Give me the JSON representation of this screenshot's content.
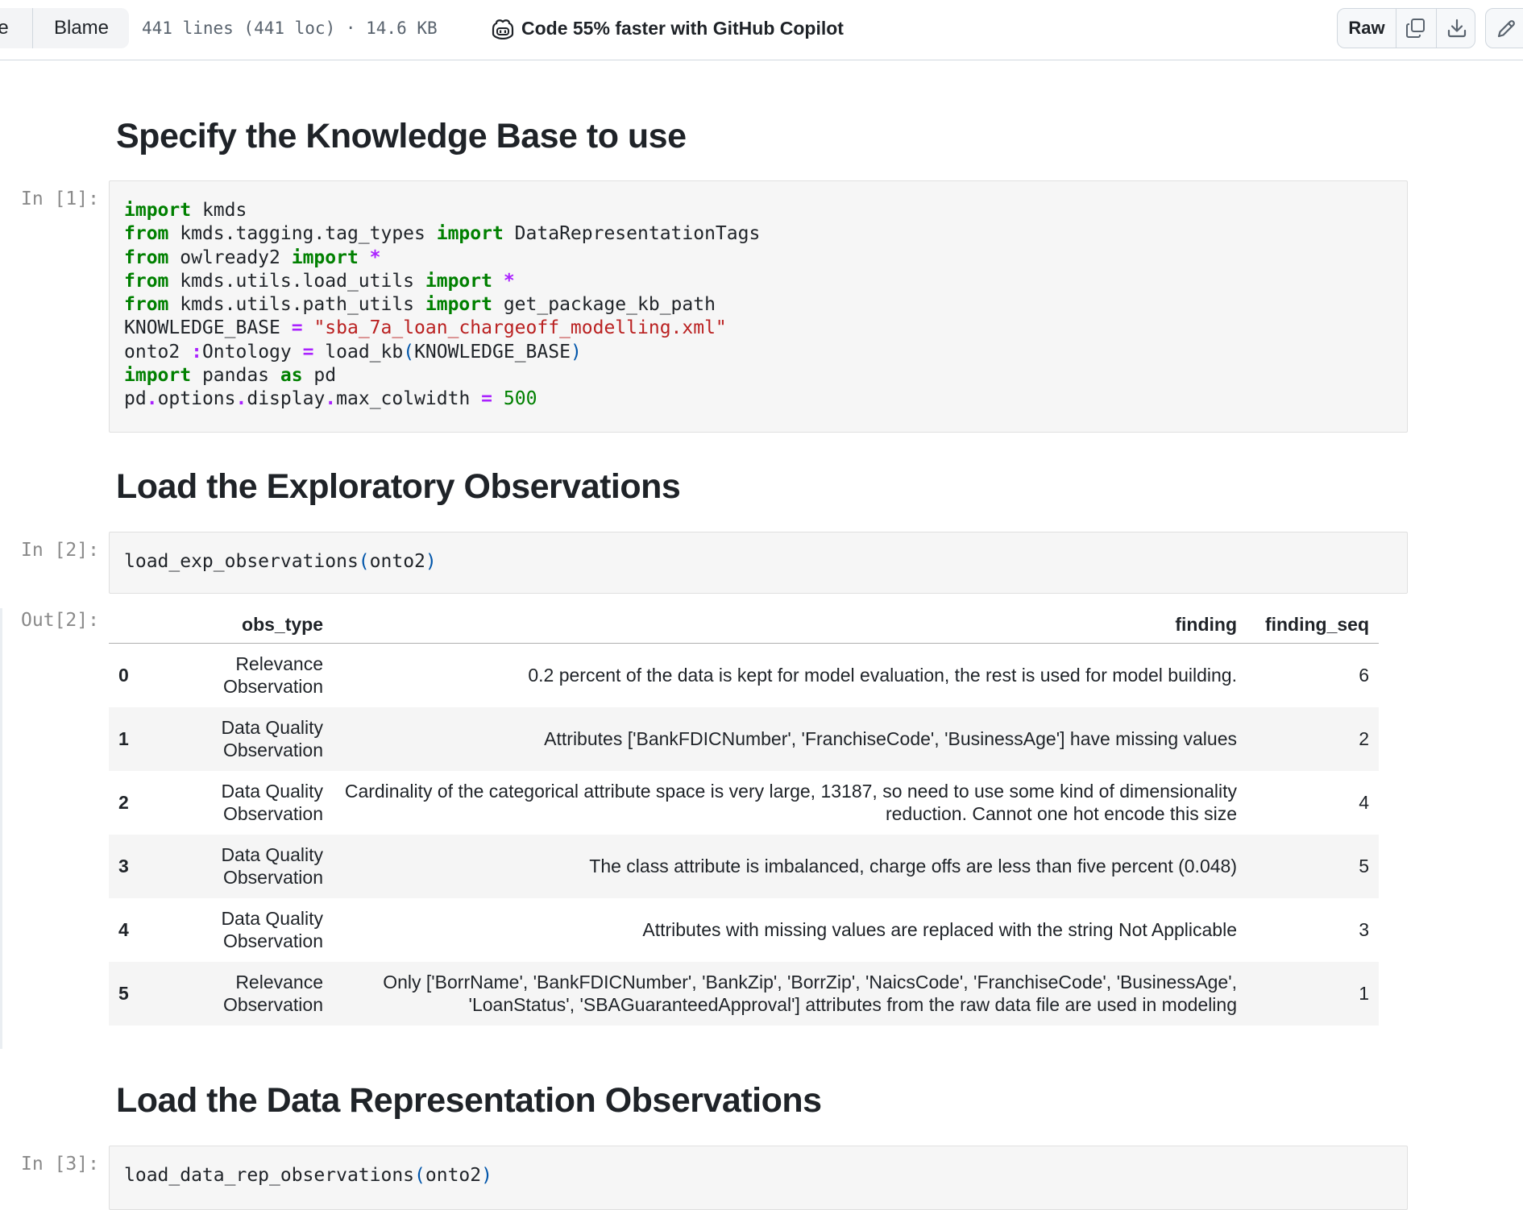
{
  "toolbar": {
    "prev_tab_fragment": "le",
    "blame_label": "Blame",
    "file_meta": "441 lines (441 loc) · 14.6 KB",
    "copilot_text": "Code 55% faster with GitHub Copilot",
    "raw_label": "Raw"
  },
  "sections": [
    {
      "heading": "Specify the Knowledge Base to use",
      "prompt": "In [1]:"
    },
    {
      "heading": "Load the Exploratory Observations",
      "prompt": "In [2]:",
      "code": "load_exp_observations(onto2)",
      "out_prompt": "Out[2]:"
    },
    {
      "heading": "Load the Data Representation Observations",
      "prompt": "In [3]:",
      "code": "load_data_rep_observations(onto2)"
    }
  ],
  "dataframe": {
    "columns": [
      "obs_type",
      "finding",
      "finding_seq"
    ],
    "rows": [
      {
        "index": "0",
        "obs_type": "Relevance Observation",
        "finding": "0.2 percent of the data is kept for model evaluation, the rest is used for model building.",
        "finding_seq": "6"
      },
      {
        "index": "1",
        "obs_type": "Data Quality Observation",
        "finding": "Attributes ['BankFDICNumber', 'FranchiseCode', 'BusinessAge'] have missing values",
        "finding_seq": "2"
      },
      {
        "index": "2",
        "obs_type": "Data Quality Observation",
        "finding": "Cardinality of the categorical attribute space is very large, 13187, so need to use some kind of dimensionality reduction. Cannot one hot encode this size",
        "finding_seq": "4"
      },
      {
        "index": "3",
        "obs_type": "Data Quality Observation",
        "finding": "The class attribute is imbalanced, charge offs are less than five percent (0.048)",
        "finding_seq": "5"
      },
      {
        "index": "4",
        "obs_type": "Data Quality Observation",
        "finding": "Attributes with missing values are replaced with the string Not Applicable",
        "finding_seq": "3"
      },
      {
        "index": "5",
        "obs_type": "Relevance Observation",
        "finding": "Only ['BorrName', 'BankFDICNumber', 'BankZip', 'BorrZip', 'NaicsCode', 'FranchiseCode', 'BusinessAge', 'LoanStatus', 'SBAGuaranteedApproval'] attributes from the raw data file are used in modeling",
        "finding_seq": "1"
      }
    ]
  },
  "icons": {
    "copilot": "copilot-icon",
    "copy": "copy-icon",
    "download": "download-icon",
    "edit": "pencil-icon"
  }
}
